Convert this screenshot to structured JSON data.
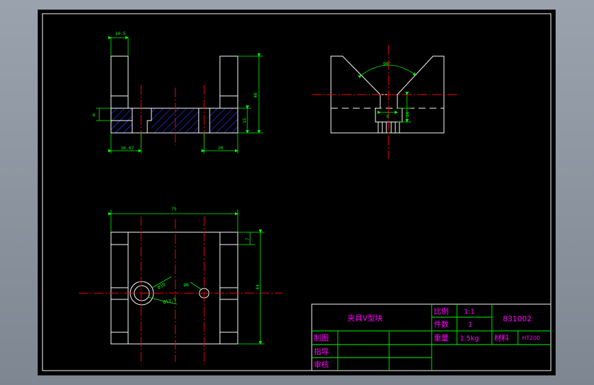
{
  "colors": {
    "outline": "#ffffff",
    "dimension": "#00ff00",
    "centerline": "#ff0000",
    "hatch": "#3333ff",
    "titleblock_text": "#ff00ff",
    "viewport_bg": "#000000"
  },
  "dimensions": {
    "top_width": "10.5",
    "slot_depth": "8",
    "right_height": "40",
    "right_lower": "15",
    "bottom_left": "16.67",
    "bottom_right": "20",
    "v_angle": "90°",
    "v_slot_width": "8",
    "v_slot_height": "10",
    "plan_width": "75",
    "plan_top_offset": "7",
    "plan_height": "44",
    "hole_large_dia": "Ø10",
    "hole_cbore_dia": "Ø13.5",
    "hole_small_dia": "Ø6"
  },
  "title_block": {
    "part_name": "夹具V型块",
    "scale_label": "比例",
    "scale_value": "1:1",
    "drawing_number": "831002",
    "qty_label": "件数",
    "qty_value": "1",
    "weight_label": "重量",
    "weight_value": "1.5kg",
    "material_label": "材料",
    "material_value": "HT200",
    "drawn_label": "制图",
    "guide_label": "指导",
    "review_label": "审核"
  }
}
